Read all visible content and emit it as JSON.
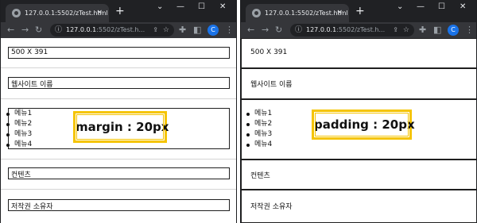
{
  "browser": {
    "tab_title": "127.0.0.1:5502/zTest.html",
    "tab_close": "×",
    "new_tab": "+",
    "window_buttons": [
      "⌄",
      "—",
      "☐",
      "✕"
    ],
    "url_host": "127.0.0.1",
    "url_path": ":5502/zTest.h...",
    "profile_initial": "C"
  },
  "left_panel": {
    "boxes": [
      "500 X 391",
      "웹사이트 이름",
      "컨텐츠",
      "저작권 소유자"
    ],
    "menu_items": [
      "메뉴1",
      "메뉴2",
      "메뉴3",
      "메뉴4"
    ],
    "callout": "margin : 20px"
  },
  "right_panel": {
    "boxes": [
      "500 X 391",
      "웹사이트 이름",
      "컨텐츠",
      "저작권 소유자"
    ],
    "menu_items": [
      "메뉴1",
      "메뉴2",
      "메뉴3",
      "메뉴4"
    ],
    "callout": "padding : 20px"
  },
  "colors": {
    "tabstrip": "#202124",
    "toolbar": "#35363a",
    "callout_border": "#f5c400",
    "box_border": "#1f1f1f",
    "avatar": "#1a73e8"
  }
}
